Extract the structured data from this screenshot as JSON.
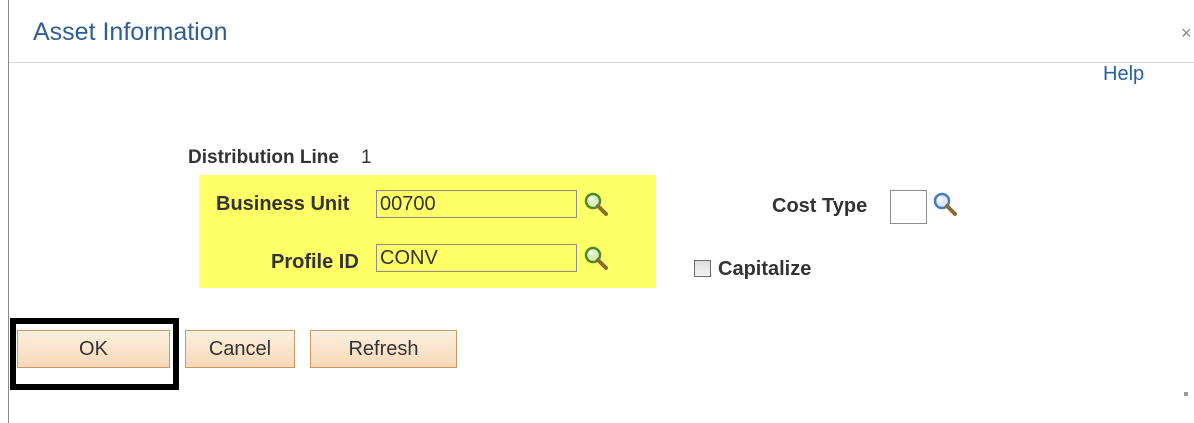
{
  "dialog": {
    "title": "Asset Information",
    "close_symbol": "×",
    "help_label": "Help"
  },
  "distribution": {
    "label": "Distribution Line",
    "value": "1"
  },
  "fields": {
    "business_unit": {
      "label": "Business Unit",
      "value": "00700"
    },
    "profile_id": {
      "label": "Profile ID",
      "value": "CONV"
    },
    "cost_type": {
      "label": "Cost Type",
      "value": ""
    },
    "capitalize": {
      "label": "Capitalize",
      "checked": false
    }
  },
  "buttons": {
    "ok": "OK",
    "cancel": "Cancel",
    "refresh": "Refresh"
  },
  "icons": {
    "lookup": "magnifying-glass-icon",
    "close": "close-icon"
  },
  "colors": {
    "title": "#2f5e94",
    "highlight": "#ffff66",
    "button_bg": "#f6d8b6",
    "focus_border": "#000000"
  }
}
